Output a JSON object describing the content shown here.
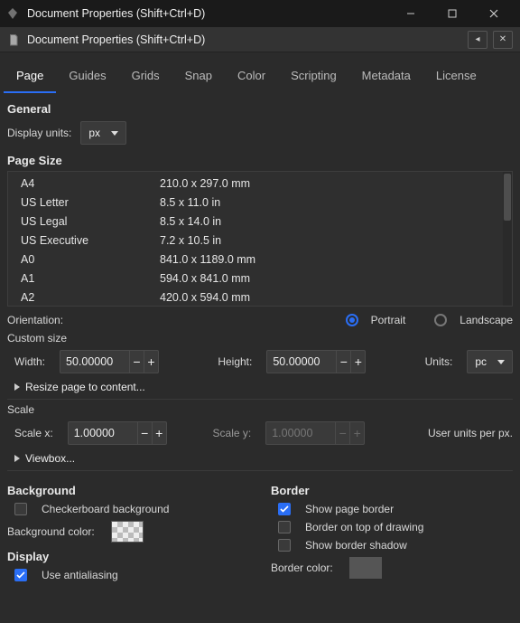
{
  "window": {
    "title": "Document Properties (Shift+Ctrl+D)"
  },
  "panel": {
    "title": "Document Properties (Shift+Ctrl+D)"
  },
  "tabs": [
    "Page",
    "Guides",
    "Grids",
    "Snap",
    "Color",
    "Scripting",
    "Metadata",
    "License"
  ],
  "activeTab": 0,
  "general": {
    "heading": "General",
    "displayUnitsLabel": "Display units:",
    "displayUnitsValue": "px"
  },
  "pageSize": {
    "heading": "Page Size",
    "items": [
      {
        "name": "A4",
        "dim": "210.0 x 297.0 mm"
      },
      {
        "name": "US Letter",
        "dim": "8.5 x 11.0 in"
      },
      {
        "name": "US Legal",
        "dim": "8.5 x 14.0 in"
      },
      {
        "name": "US Executive",
        "dim": "7.2 x 10.5 in"
      },
      {
        "name": "A0",
        "dim": "841.0 x 1189.0 mm"
      },
      {
        "name": "A1",
        "dim": "594.0 x 841.0 mm"
      },
      {
        "name": "A2",
        "dim": "420.0 x 594.0 mm"
      }
    ],
    "orientationLabel": "Orientation:",
    "portraitLabel": "Portrait",
    "landscapeLabel": "Landscape",
    "orientation": "portrait",
    "customHeading": "Custom size",
    "widthLabel": "Width:",
    "widthValue": "50.00000",
    "heightLabel": "Height:",
    "heightValue": "50.00000",
    "unitsLabel": "Units:",
    "unitsValue": "pc",
    "resizeExpander": "Resize page to content..."
  },
  "scale": {
    "heading": "Scale",
    "scaleXLabel": "Scale x:",
    "scaleXValue": "1.00000",
    "scaleYLabel": "Scale y:",
    "scaleYValue": "1.00000",
    "rightLabel": "User units per px.",
    "viewboxExpander": "Viewbox..."
  },
  "bottom": {
    "backgroundHeading": "Background",
    "checkerboardLabel": "Checkerboard background",
    "checkerboardChecked": false,
    "bgColorLabel": "Background color:",
    "displayHeading": "Display",
    "antialiasLabel": "Use antialiasing",
    "antialiasChecked": true,
    "borderHeading": "Border",
    "showBorderLabel": "Show page border",
    "showBorderChecked": true,
    "borderOnTopLabel": "Border on top of drawing",
    "borderOnTopChecked": false,
    "showShadowLabel": "Show border shadow",
    "showShadowChecked": false,
    "borderColorLabel": "Border color:"
  }
}
